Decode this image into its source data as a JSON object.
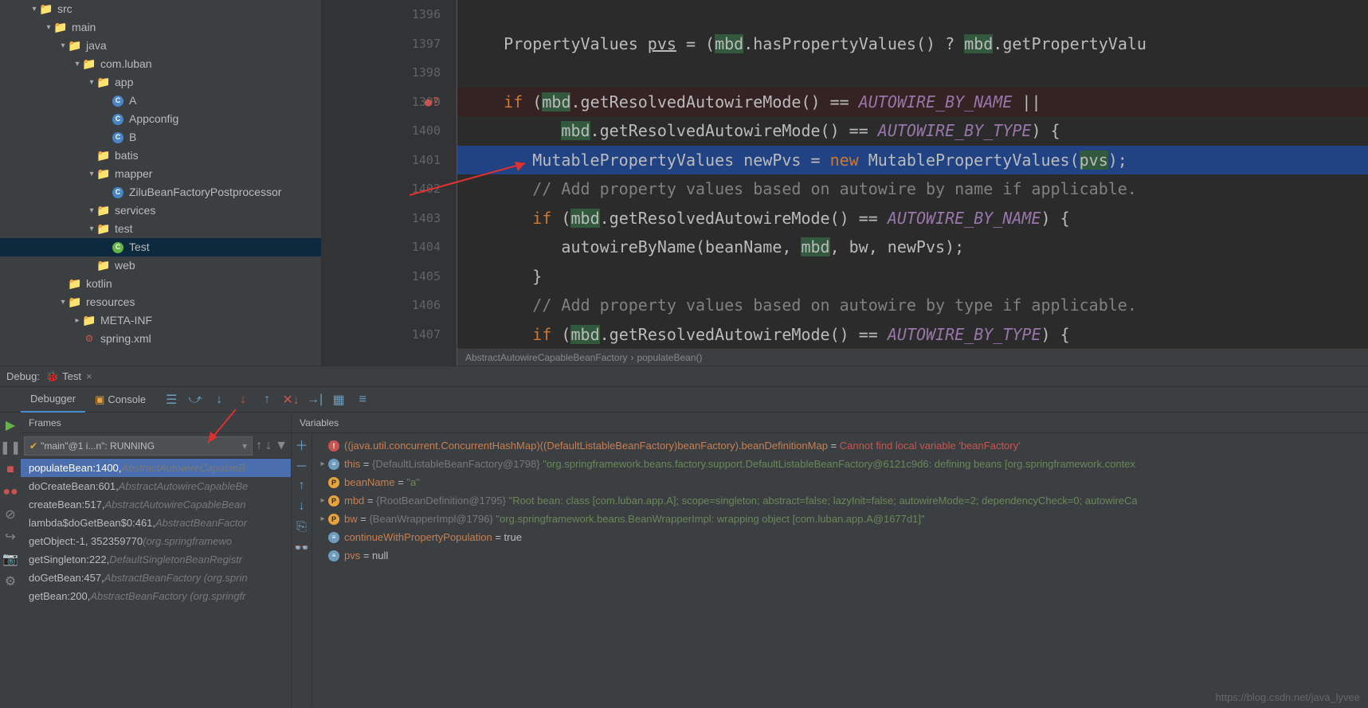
{
  "tree": {
    "items": [
      {
        "indent": 2,
        "exp": "▾",
        "icon": "folder-blue",
        "label": "src"
      },
      {
        "indent": 3,
        "exp": "▾",
        "icon": "folder-blue",
        "label": "main"
      },
      {
        "indent": 4,
        "exp": "▾",
        "icon": "folder-blue",
        "label": "java"
      },
      {
        "indent": 5,
        "exp": "▾",
        "icon": "folder",
        "label": "com.luban"
      },
      {
        "indent": 6,
        "exp": "▾",
        "icon": "folder",
        "label": "app"
      },
      {
        "indent": 7,
        "exp": "",
        "icon": "class",
        "label": "A"
      },
      {
        "indent": 7,
        "exp": "",
        "icon": "class",
        "label": "Appconfig"
      },
      {
        "indent": 7,
        "exp": "",
        "icon": "class",
        "label": "B"
      },
      {
        "indent": 6,
        "exp": "",
        "icon": "folder",
        "label": "batis"
      },
      {
        "indent": 6,
        "exp": "▾",
        "icon": "folder",
        "label": "mapper"
      },
      {
        "indent": 7,
        "exp": "",
        "icon": "class",
        "label": "ZiluBeanFactoryPostprocessor"
      },
      {
        "indent": 6,
        "exp": "▾",
        "icon": "folder",
        "label": "services"
      },
      {
        "indent": 6,
        "exp": "▾",
        "icon": "folder",
        "label": "test"
      },
      {
        "indent": 7,
        "exp": "",
        "icon": "class-run",
        "label": "Test",
        "selected": true
      },
      {
        "indent": 6,
        "exp": "",
        "icon": "folder",
        "label": "web"
      },
      {
        "indent": 4,
        "exp": "",
        "icon": "folder-blue",
        "label": "kotlin"
      },
      {
        "indent": 4,
        "exp": "▾",
        "icon": "folder-res",
        "label": "resources"
      },
      {
        "indent": 5,
        "exp": "▸",
        "icon": "folder",
        "label": "META-INF"
      },
      {
        "indent": 5,
        "exp": "",
        "icon": "xml",
        "label": "spring.xml"
      }
    ]
  },
  "editor": {
    "lines": [
      {
        "n": 1396,
        "html": ""
      },
      {
        "n": 1397,
        "html": "    PropertyValues <u>pvs</u> = (<span class='hi'>mbd</span>.hasPropertyValues() ? <span class='hi'>mbd</span>.getPropertyValu"
      },
      {
        "n": 1398,
        "html": ""
      },
      {
        "n": 1399,
        "html": "    <span class='kw'>if</span> (<span class='hi'>mbd</span>.getResolvedAutowireMode() == <span class='const'>AUTOWIRE_BY_NAME</span> ||",
        "bp": true
      },
      {
        "n": 1400,
        "html": "          <span class='hi'>mbd</span>.getResolvedAutowireMode() == <span class='const'>AUTOWIRE_BY_TYPE</span>) {"
      },
      {
        "n": 1401,
        "html": "       MutablePropertyValues newPvs = <span class='kw'>new</span> MutablePropertyValues(<span class='hi'>pvs</span>);",
        "exec": true
      },
      {
        "n": 1402,
        "html": "       <span class='cmt'>// Add property values based on autowire by name if applicable.</span>"
      },
      {
        "n": 1403,
        "html": "       <span class='kw'>if</span> (<span class='hi'>mbd</span>.getResolvedAutowireMode() == <span class='const'>AUTOWIRE_BY_NAME</span>) {"
      },
      {
        "n": 1404,
        "html": "          autowireByName(beanName, <span class='hi'>mbd</span>, bw, newPvs);"
      },
      {
        "n": 1405,
        "html": "       }"
      },
      {
        "n": 1406,
        "html": "       <span class='cmt'>// Add property values based on autowire by type if applicable.</span>"
      },
      {
        "n": 1407,
        "html": "       <span class='kw'>if</span> (<span class='hi'>mbd</span>.getResolvedAutowireMode() == <span class='const'>AUTOWIRE_BY_TYPE</span>) {"
      }
    ],
    "breadcrumb": [
      "AbstractAutowireCapableBeanFactory",
      "›",
      "populateBean()"
    ]
  },
  "debug": {
    "label": "Debug:",
    "config": "Test",
    "tabs": {
      "debugger": "Debugger",
      "console": "Console"
    },
    "frames_title": "Frames",
    "vars_title": "Variables",
    "thread": "\"main\"@1 i...n\": RUNNING",
    "frames": [
      {
        "m": "populateBean:1400, ",
        "c": "AbstractAutowireCapableB",
        "sel": true
      },
      {
        "m": "doCreateBean:601, ",
        "c": "AbstractAutowireCapableBe"
      },
      {
        "m": "createBean:517, ",
        "c": "AbstractAutowireCapableBean"
      },
      {
        "m": "lambda$doGetBean$0:461, ",
        "c": "AbstractBeanFactor"
      },
      {
        "m": "getObject:-1, 352359770 ",
        "c": "(org.springframewo"
      },
      {
        "m": "getSingleton:222, ",
        "c": "DefaultSingletonBeanRegistr"
      },
      {
        "m": "doGetBean:457, ",
        "c": "AbstractBeanFactory (org.sprin"
      },
      {
        "m": "getBean:200, ",
        "c": "AbstractBeanFactory (org.springfr"
      }
    ],
    "vars": [
      {
        "exp": "",
        "icon": "err",
        "html": "<span style='color:#c77e51'>((java.util.concurrent.ConcurrentHashMap)((DefaultListableBeanFactory)beanFactory).beanDefinitionMap</span> = <span class='var-err'>Cannot find local variable 'beanFactory'</span>"
      },
      {
        "exp": "▸",
        "icon": "eq",
        "html": "<span class='var-name'>this</span> = <span class='var-type'>{DefaultListableBeanFactory@1798}</span> <span class='var-val'>\"org.springframework.beans.factory.support.DefaultListableBeanFactory@6121c9d6: defining beans [org.springframework.contex</span>"
      },
      {
        "exp": "",
        "icon": "p",
        "html": "<span class='var-name'>beanName</span> = <span class='var-val'>\"a\"</span>"
      },
      {
        "exp": "▸",
        "icon": "p",
        "html": "<span class='var-name'>mbd</span> = <span class='var-type'>{RootBeanDefinition@1795}</span> <span class='var-val'>\"Root bean: class [com.luban.app.A]; scope=singleton; abstract=false; lazyInit=false; autowireMode=2; dependencyCheck=0; autowireCa</span>"
      },
      {
        "exp": "▸",
        "icon": "p",
        "html": "<span class='var-name'>bw</span> = <span class='var-type'>{BeanWrapperImpl@1796}</span> <span class='var-val'>\"org.springframework.beans.BeanWrapperImpl: wrapping object [com.luban.app.A@1677d1]\"</span>"
      },
      {
        "exp": "",
        "icon": "eq",
        "html": "<span class='var-name'>continueWithPropertyPopulation</span> = true"
      },
      {
        "exp": "",
        "icon": "eq",
        "html": "<span class='var-name'>pvs</span> = null"
      }
    ]
  },
  "watermark": "https://blog.csdn.net/java_lyvee"
}
